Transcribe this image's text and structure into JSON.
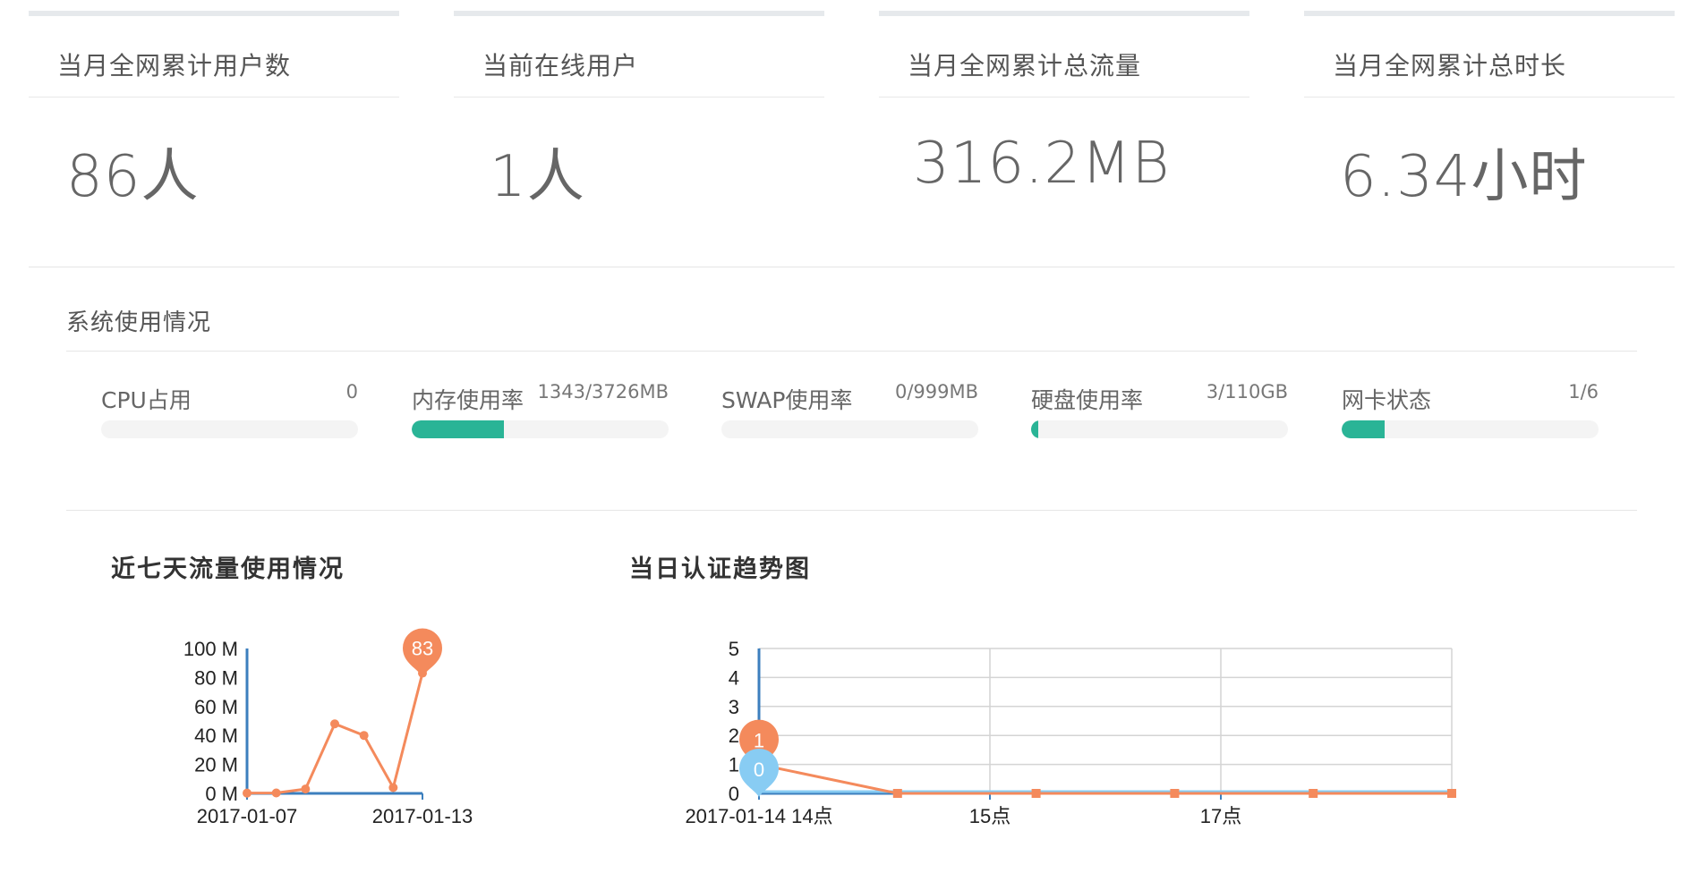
{
  "stats": [
    {
      "title": "当月全网累计用户数",
      "value": "86人"
    },
    {
      "title": "当前在线用户",
      "value": "1人"
    },
    {
      "title": "当月全网累计总流量",
      "value": "316.2MB"
    },
    {
      "title": "当月全网累计总时长",
      "value": "6.34小时"
    }
  ],
  "system": {
    "title": "系统使用情况",
    "items": [
      {
        "label": "CPU占用",
        "value": "0",
        "percent": 0
      },
      {
        "label": "内存使用率",
        "value": "1343/3726MB",
        "percent": 36
      },
      {
        "label": "SWAP使用率",
        "value": "0/999MB",
        "percent": 0
      },
      {
        "label": "硬盘使用率",
        "value": "3/110GB",
        "percent": 2.7
      },
      {
        "label": "网卡状态",
        "value": "1/6",
        "percent": 16.7
      }
    ]
  },
  "colors": {
    "accent": "#2ab496",
    "series_orange": "#f48a5c",
    "series_blue": "#88ccf3",
    "axis": "#3c7fbe"
  },
  "chart_data": [
    {
      "type": "line",
      "title": "近七天流量使用情况",
      "x": [
        "2017-01-07",
        "2017-01-08",
        "2017-01-09",
        "2017-01-10",
        "2017-01-11",
        "2017-01-12",
        "2017-01-13"
      ],
      "x_tick_labels": [
        "2017-01-07",
        "2017-01-13"
      ],
      "y_ticks": [
        "0 M",
        "20 M",
        "40 M",
        "60 M",
        "80 M",
        "100 M"
      ],
      "ylim": [
        0,
        100
      ],
      "series": [
        {
          "values": [
            0.2,
            0.3,
            3,
            48,
            40,
            4,
            83
          ]
        }
      ],
      "annotations": [
        {
          "index": 6,
          "label": "83"
        }
      ]
    },
    {
      "type": "line",
      "title": "当日认证趋势图",
      "x_tick_labels": [
        "2017-01-14 14点",
        "15点",
        "17点"
      ],
      "y_ticks": [
        "0",
        "1",
        "2",
        "3",
        "4",
        "5"
      ],
      "ylim": [
        0,
        5
      ],
      "series": [
        {
          "values": [
            1,
            0,
            0,
            0,
            0,
            0
          ]
        },
        {
          "values": [
            0,
            0,
            0,
            0,
            0,
            0
          ]
        }
      ],
      "annotations": [
        {
          "series": 0,
          "index": 0,
          "label": "1"
        },
        {
          "series": 1,
          "index": 0,
          "label": "0"
        }
      ]
    }
  ]
}
